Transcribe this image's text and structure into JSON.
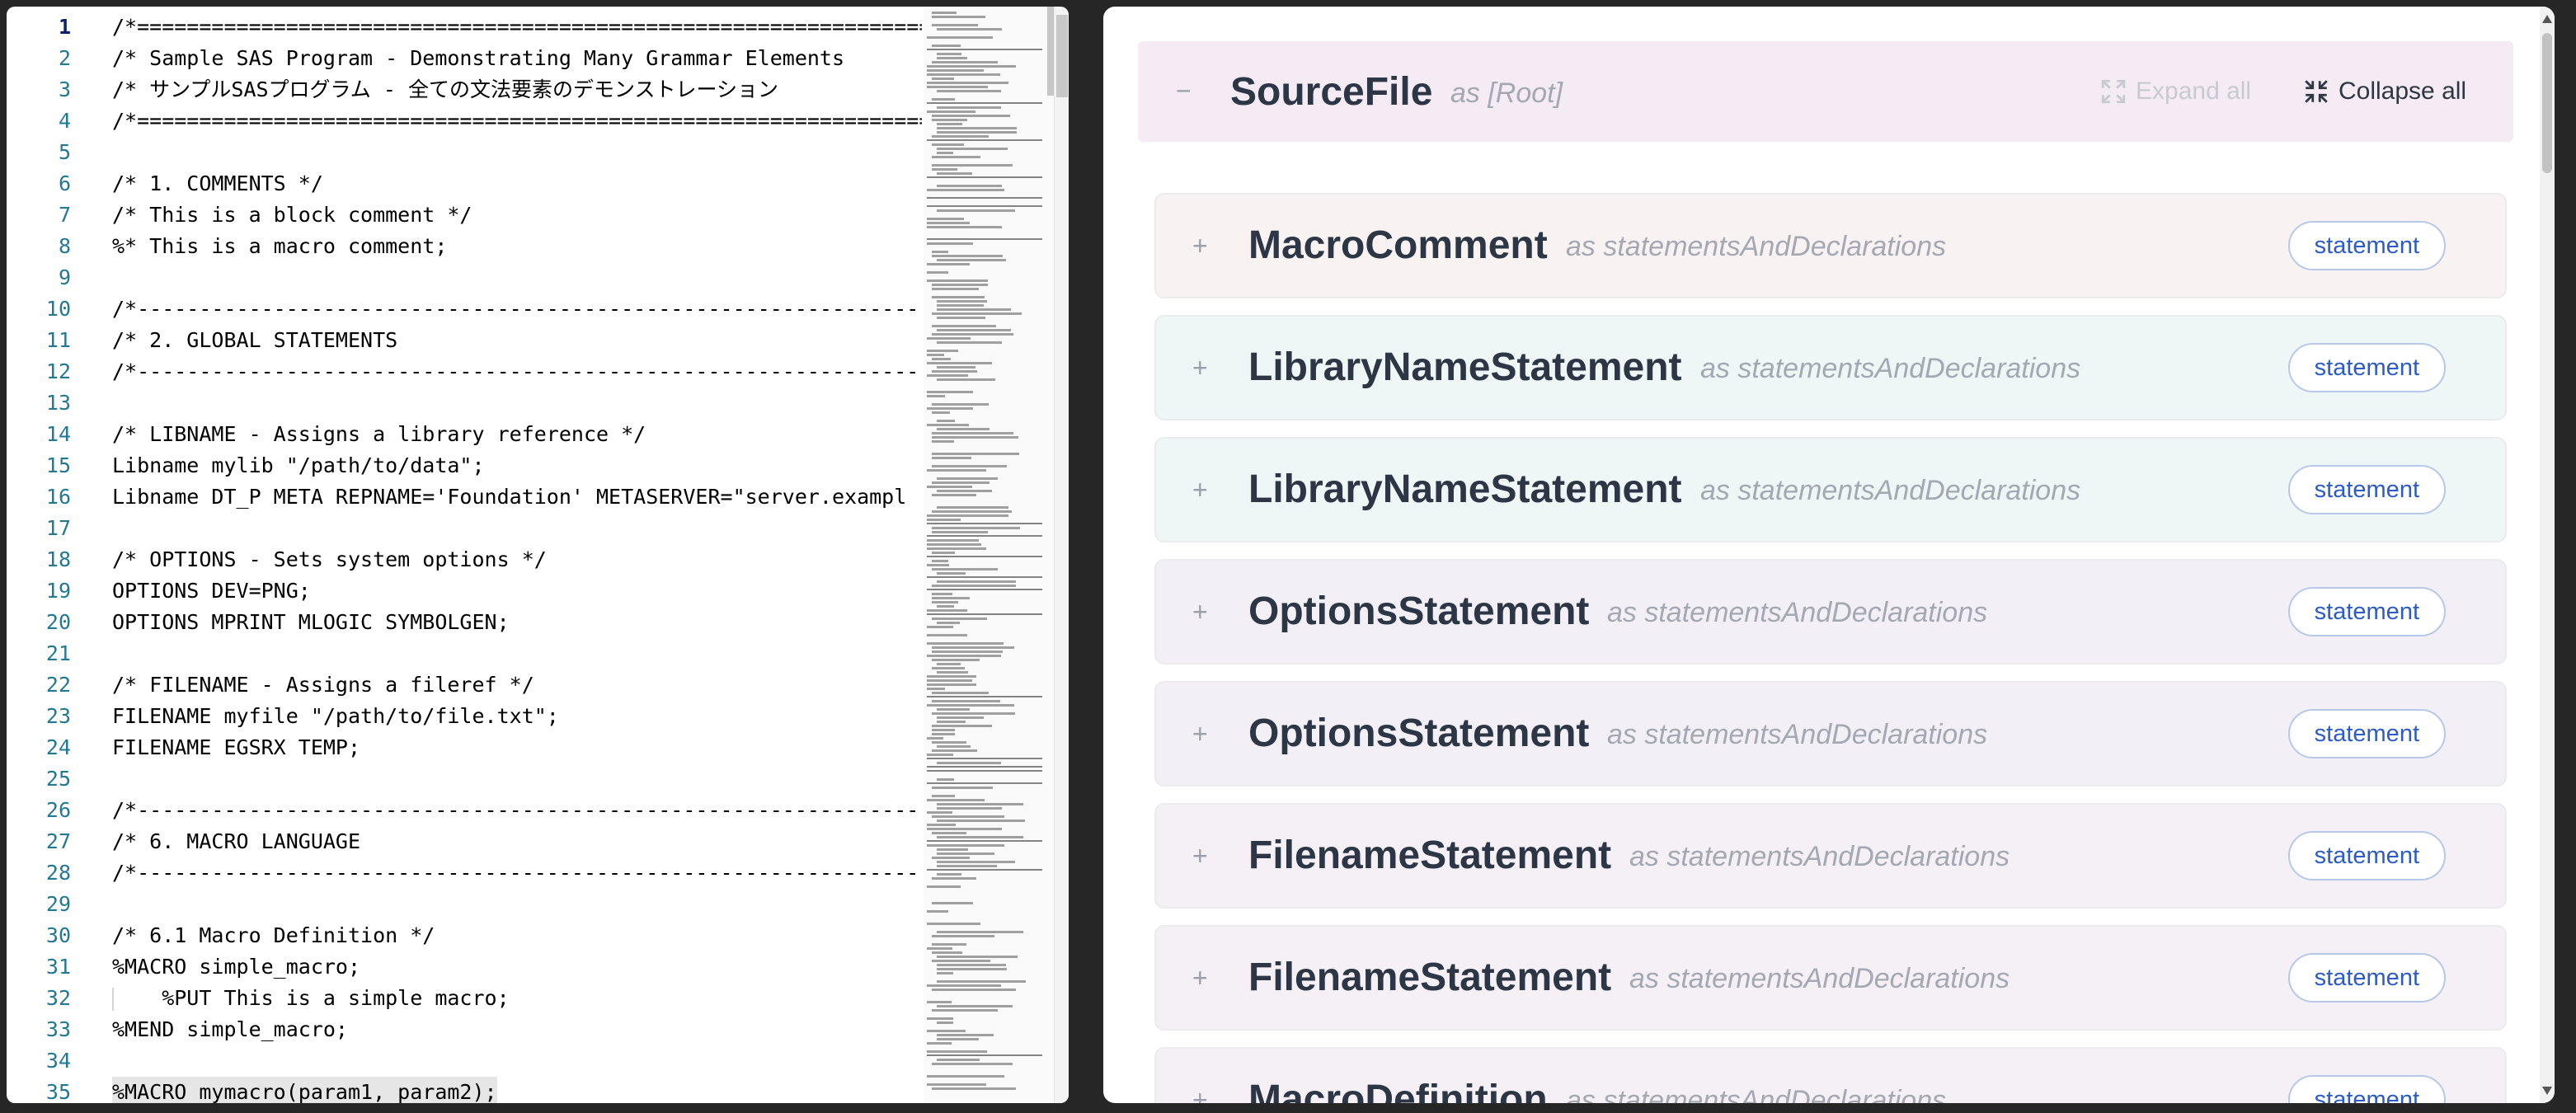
{
  "editor": {
    "active_line": 1,
    "highlight_line": 35,
    "lines": [
      "/*================================================================================*/",
      "/* Sample SAS Program - Demonstrating Many Grammar Elements",
      "/* サンプルSASプログラム - 全ての文法要素のデモンストレーション",
      "/*================================================================================*/",
      "",
      "/* 1. COMMENTS */",
      "/* This is a block comment */",
      "%* This is a macro comment;",
      "",
      "/*--------------------------------------------------------------------------------*/",
      "/* 2. GLOBAL STATEMENTS",
      "/*--------------------------------------------------------------------------------*/",
      "",
      "/* LIBNAME - Assigns a library reference */",
      "Libname mylib \"/path/to/data\";",
      "Libname DT_P META REPNAME='Foundation' METASERVER=\"server.exampl",
      "",
      "/* OPTIONS - Sets system options */",
      "OPTIONS DEV=PNG;",
      "OPTIONS MPRINT MLOGIC SYMBOLGEN;",
      "",
      "/* FILENAME - Assigns a fileref */",
      "FILENAME myfile \"/path/to/file.txt\";",
      "FILENAME EGSRX TEMP;",
      "",
      "/*--------------------------------------------------------------------------------*/",
      "/* 6. MACRO LANGUAGE",
      "/*--------------------------------------------------------------------------------*/",
      "",
      "/* 6.1 Macro Definition */",
      "%MACRO simple_macro;",
      "    %PUT This is a simple macro;",
      "%MEND simple_macro;",
      "",
      "%MACRO mymacro(param1, param2);"
    ]
  },
  "tree": {
    "root": {
      "toggle": "−",
      "name": "SourceFile",
      "role": "as [Root]",
      "expand_all": "Expand all",
      "collapse_all": "Collapse all"
    },
    "nodes": [
      {
        "name": "MacroComment",
        "role": "as statementsAndDeclarations",
        "badge": "statement",
        "bg": "#f8f3f2"
      },
      {
        "name": "LibraryNameStatement",
        "role": "as statementsAndDeclarations",
        "badge": "statement",
        "bg": "#eff6f6"
      },
      {
        "name": "LibraryNameStatement",
        "role": "as statementsAndDeclarations",
        "badge": "statement",
        "bg": "#eff6f6"
      },
      {
        "name": "OptionsStatement",
        "role": "as statementsAndDeclarations",
        "badge": "statement",
        "bg": "#f2f0f6"
      },
      {
        "name": "OptionsStatement",
        "role": "as statementsAndDeclarations",
        "badge": "statement",
        "bg": "#f2f0f6"
      },
      {
        "name": "FilenameStatement",
        "role": "as statementsAndDeclarations",
        "badge": "statement",
        "bg": "#f5eff6"
      },
      {
        "name": "FilenameStatement",
        "role": "as statementsAndDeclarations",
        "badge": "statement",
        "bg": "#f5eff6"
      },
      {
        "name": "MacroDefinition",
        "role": "as statementsAndDeclarations",
        "badge": "statement",
        "bg": "#f5eff6"
      }
    ],
    "toggle_collapsed": "+"
  }
}
